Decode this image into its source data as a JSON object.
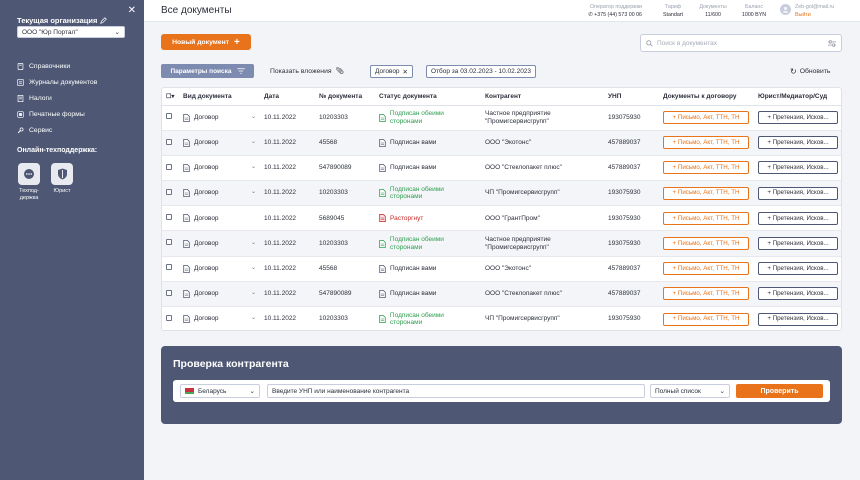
{
  "sidebar": {
    "org_title": "Текущая организация",
    "org_selected": "ООО \"Юр Портал\"",
    "menu": [
      {
        "label": "Справочники",
        "icon": "book-icon"
      },
      {
        "label": "Журналы документов",
        "icon": "journal-icon"
      },
      {
        "label": "Налоги",
        "icon": "tax-icon"
      },
      {
        "label": "Печатные формы",
        "icon": "print-form-icon"
      },
      {
        "label": "Сервис",
        "icon": "wrench-icon"
      }
    ],
    "support_title": "Онлайн-техподдержка:",
    "support": [
      {
        "label": "Техпод-держка",
        "icon": "chat-icon"
      },
      {
        "label": "Юрист",
        "icon": "shield-icon"
      }
    ]
  },
  "header": {
    "title": "Все документы",
    "operator_label": "Оператор поддержки",
    "operator_phone": "+375 (44) 573 00 06",
    "tariff_label": "Тариф",
    "tariff_value": "Standart",
    "docs_label": "Документы",
    "docs_value": "11/600",
    "balance_label": "Баланс",
    "balance_value": "1000 BYN",
    "email": "Zeb-gol@mail.ru",
    "logout": "Выйти"
  },
  "toolbar": {
    "new_doc": "Новый документ",
    "search_placeholder": "Поиск в документах",
    "params": "Параметры поиска",
    "show_attachments": "Показать вложения",
    "chip_type": "Договор",
    "chip_period": "Отбор за 03.02.2023 - 10.02.2023",
    "refresh": "Обновить"
  },
  "table": {
    "headers": [
      "Вид документа",
      "Дата",
      "№ документа",
      "Статус документа",
      "Контрагент",
      "УНП",
      "Документы к договору",
      "Юрист/Медиатор/Суд"
    ],
    "add_docs_label": "+ Письмо, Акт, ТТН, ТН",
    "claim_label": "+ Претензия, Исков...",
    "rows": [
      {
        "type": "Договор",
        "date": "10.11.2022",
        "number": "10203303",
        "status": "Подписан обеими сторонами",
        "status_kind": "green",
        "contractor": "Частное предприятие \"Промигсервисгрупп\"",
        "unp": "193075930",
        "chev": "⌄"
      },
      {
        "type": "Договор",
        "date": "10.11.2022",
        "number": "45568",
        "status": "Подписан вами",
        "status_kind": "dark",
        "contractor": "ООО \"Экотонс\"",
        "unp": "457889037",
        "chev": "⌄"
      },
      {
        "type": "Договор",
        "date": "10.11.2022",
        "number": "547890089",
        "status": "Подписан вами",
        "status_kind": "dark",
        "contractor": "ООО \"Стеклопакет плюс\"",
        "unp": "457889037",
        "chev": "⌄"
      },
      {
        "type": "Договор",
        "date": "10.11.2022",
        "number": "10203303",
        "status": "Подписан обеими сторонами",
        "status_kind": "green",
        "contractor": "ЧП \"Промигсервисгрупп\"",
        "unp": "193075930",
        "chev": "⌄"
      },
      {
        "type": "Договор",
        "date": "10.11.2022",
        "number": "5689045",
        "status": "Расторгнут",
        "status_kind": "red",
        "contractor": "ООО \"ГрантПром\"",
        "unp": "193075930",
        "chev": ""
      },
      {
        "type": "Договор",
        "date": "10.11.2022",
        "number": "10203303",
        "status": "Подписан обеими сторонами",
        "status_kind": "green",
        "contractor": "Частное предприятие \"Промигсервисгрупп\"",
        "unp": "193075930",
        "chev": "⌄"
      },
      {
        "type": "Договор",
        "date": "10.11.2022",
        "number": "45568",
        "status": "Подписан вами",
        "status_kind": "dark",
        "contractor": "ООО \"Экотонс\"",
        "unp": "457889037",
        "chev": "⌄"
      },
      {
        "type": "Договор",
        "date": "10.11.2022",
        "number": "547890089",
        "status": "Подписан вами",
        "status_kind": "dark",
        "contractor": "ООО \"Стеклопакет плюс\"",
        "unp": "457889037",
        "chev": "⌄"
      },
      {
        "type": "Договор",
        "date": "10.11.2022",
        "number": "10203303",
        "status": "Подписан обеими сторонами",
        "status_kind": "green",
        "contractor": "ЧП \"Промигсервисгрупп\"",
        "unp": "193075930",
        "chev": "⌄"
      }
    ]
  },
  "check": {
    "title": "Проверка контрагента",
    "country": "Беларусь",
    "input_placeholder": "Введите УНП или наименование контрагента",
    "list": "Полный список",
    "button": "Проверить"
  },
  "colors": {
    "accent": "#e8731a",
    "sidebar": "#4e5875",
    "status_green": "#2e9e4f",
    "status_red": "#c62828"
  }
}
